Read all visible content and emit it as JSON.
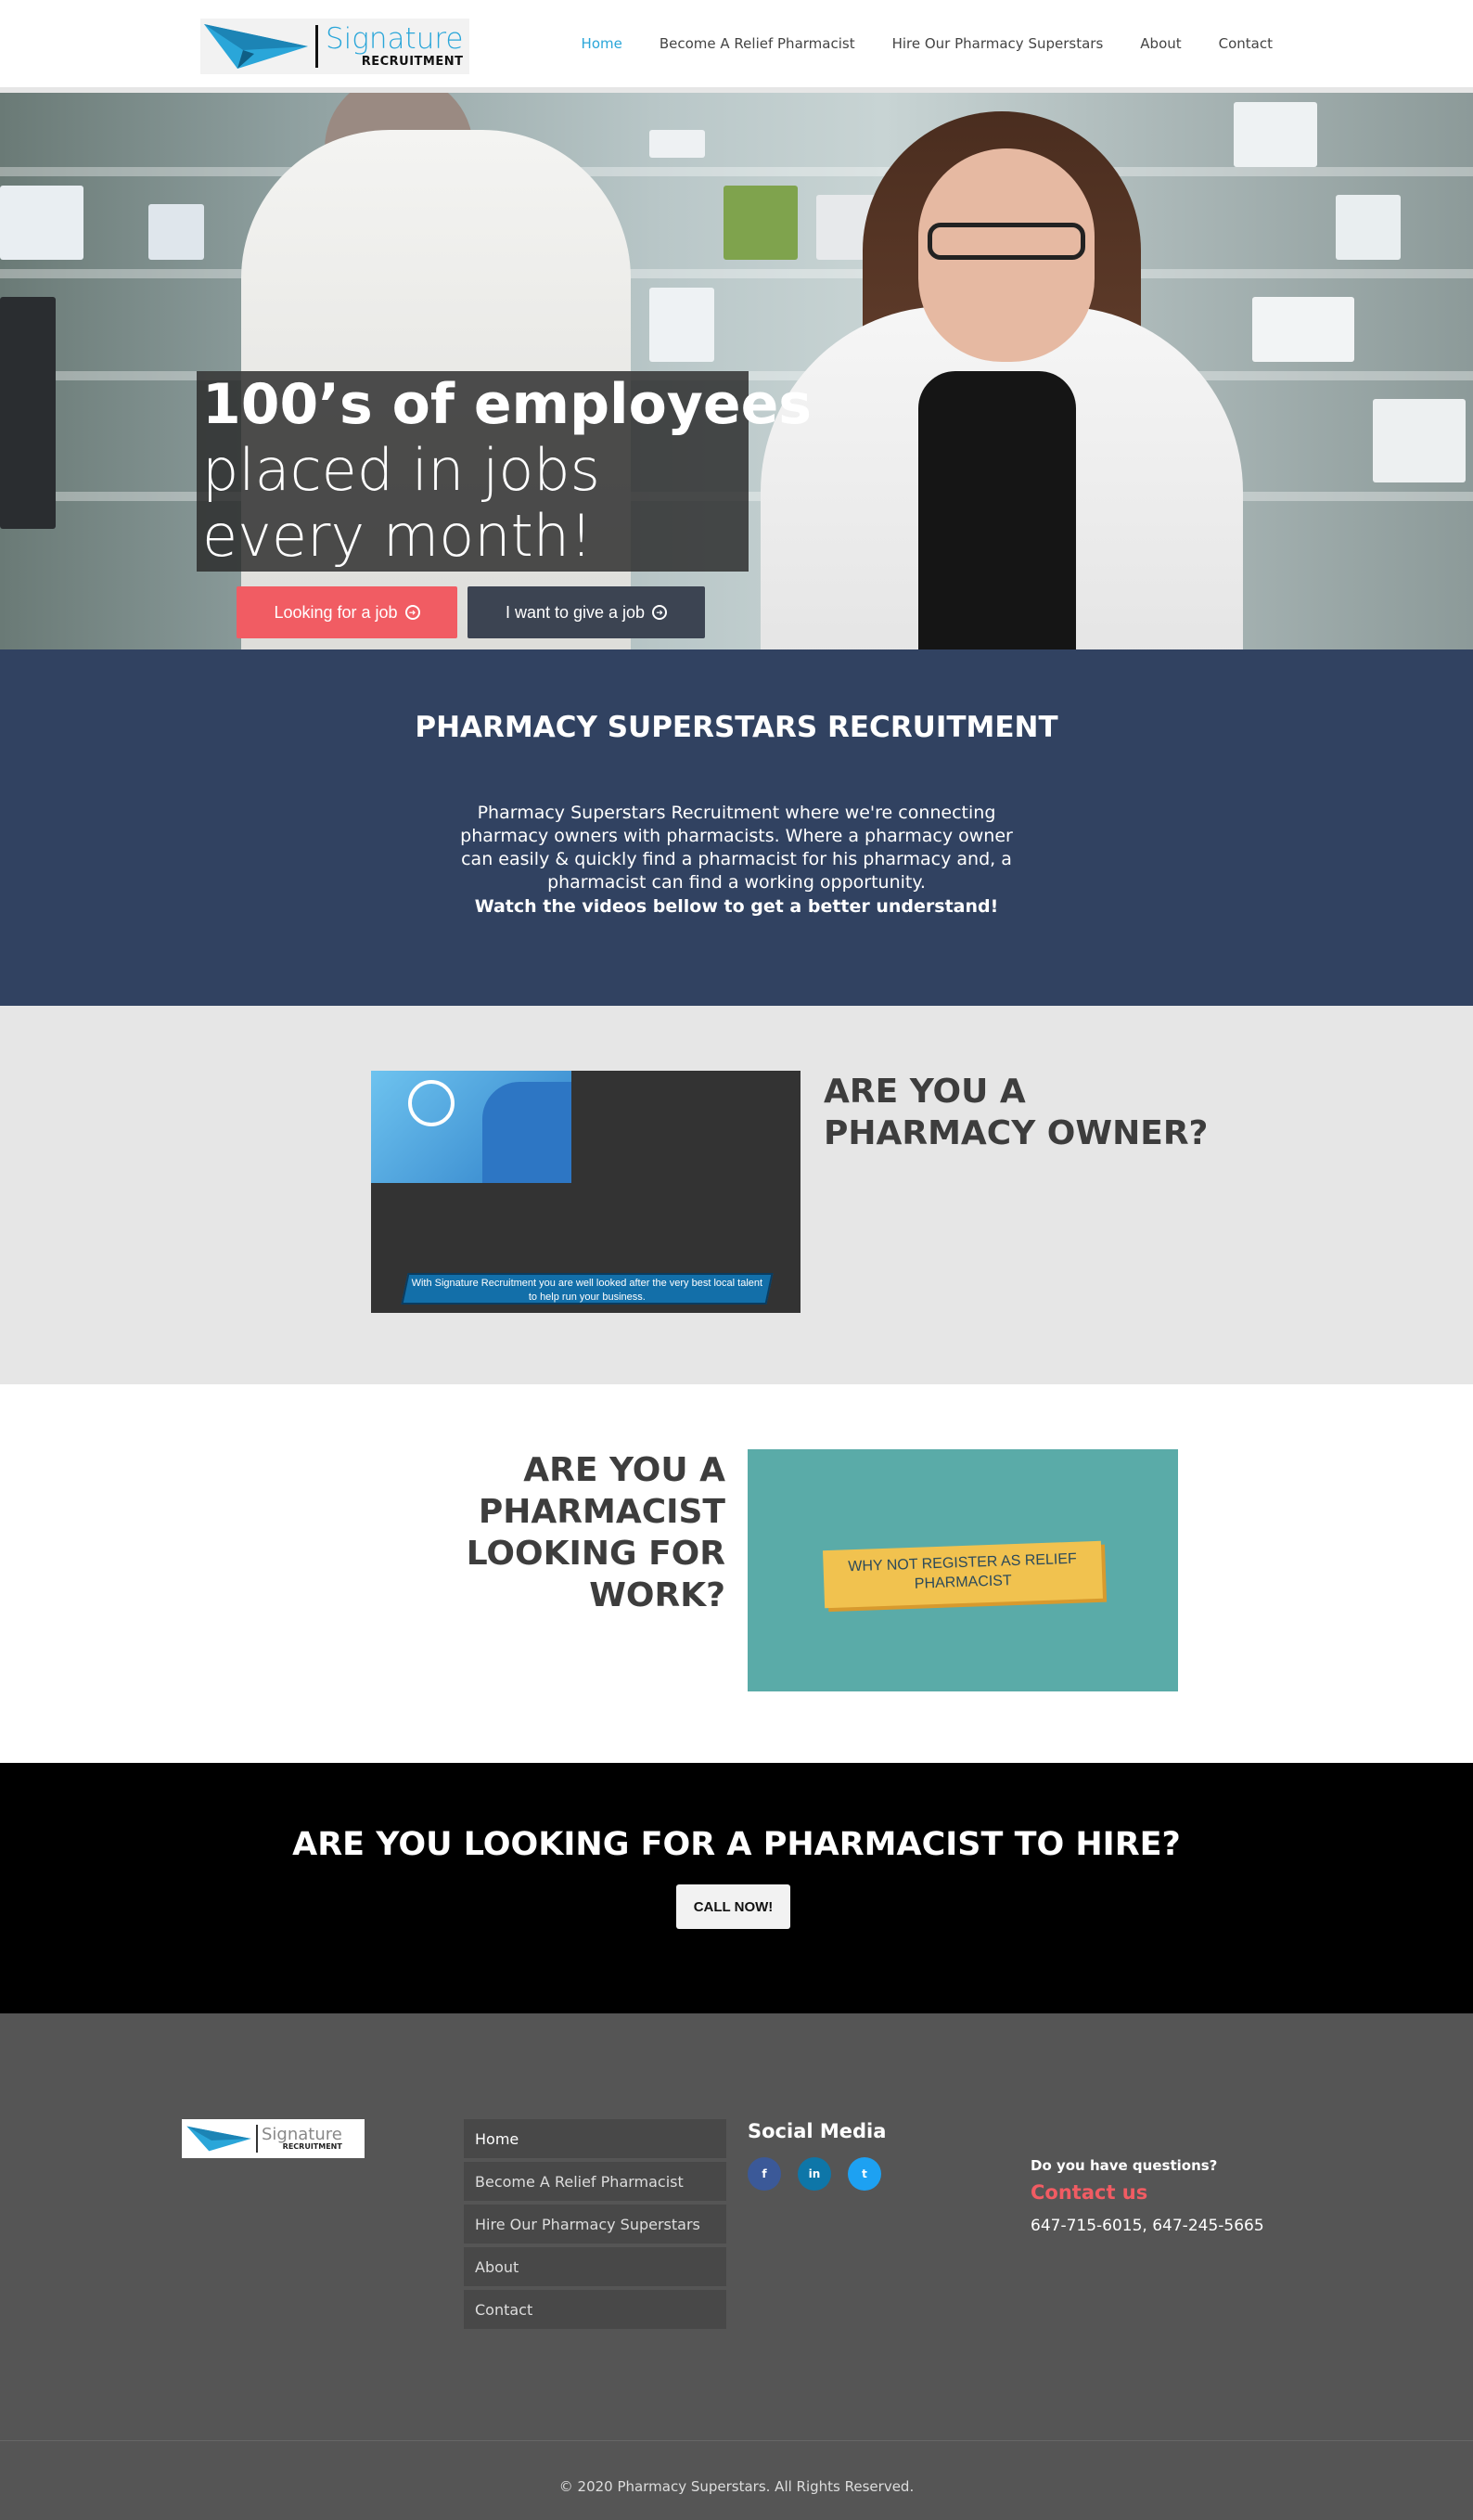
{
  "header": {
    "logo": {
      "name": "Signature",
      "sub": "RECRUITMENT"
    },
    "nav": [
      "Home",
      "Become A Relief Pharmacist",
      "Hire Our Pharmacy Superstars",
      "About",
      "Contact"
    ],
    "active_nav": "Home"
  },
  "hero": {
    "line1": "100’s of employees",
    "line2": "placed in jobs",
    "line3": "every month!",
    "btn_job": "Looking for a job",
    "btn_give": "I want to give a job"
  },
  "intro": {
    "title": "PHARMACY SUPERSTARS RECRUITMENT",
    "text": "Pharmacy Superstars Recruitment where we're connecting pharmacy owners with pharmacists. Where a pharmacy owner can easily & quickly find a pharmacist for his pharmacy and, a pharmacist can find a working opportunity.",
    "cta": "Watch the videos bellow to get a better understand!"
  },
  "owner": {
    "heading": "ARE YOU A PHARMACY OWNER?",
    "video_banner": "With Signature Recruitment you are well looked after the very best local talent to help run your business."
  },
  "pharmacist": {
    "heading": "ARE YOU A PHARMACIST LOOKING FOR WORK?",
    "video_note": "WHY NOT REGISTER AS RELIEF PHARMACIST"
  },
  "hire": {
    "heading": "ARE YOU LOOKING FOR A PHARMACIST TO HIRE?",
    "button": "CALL NOW!"
  },
  "footer": {
    "logo": {
      "name": "Signature",
      "sub": "RECRUITMENT"
    },
    "menu": [
      "Home",
      "Become A Relief Pharmacist",
      "Hire Our Pharmacy Superstars",
      "About",
      "Contact"
    ],
    "social_title": "Social Media",
    "social": [
      {
        "icon": "facebook-icon",
        "glyph": "f"
      },
      {
        "icon": "linkedin-icon",
        "glyph": "in"
      },
      {
        "icon": "twitter-icon",
        "glyph": "t"
      }
    ],
    "question": "Do you have questions?",
    "contact_label": "Contact us",
    "phones": "647-715-6015, 647-245-5665",
    "copyright": "© 2020 Pharmacy Superstars. All Rights Reserved."
  },
  "colors": {
    "accent": "#2aa6d9",
    "red": "#f15c63",
    "navy": "#314261",
    "dark": "#3c4452"
  }
}
